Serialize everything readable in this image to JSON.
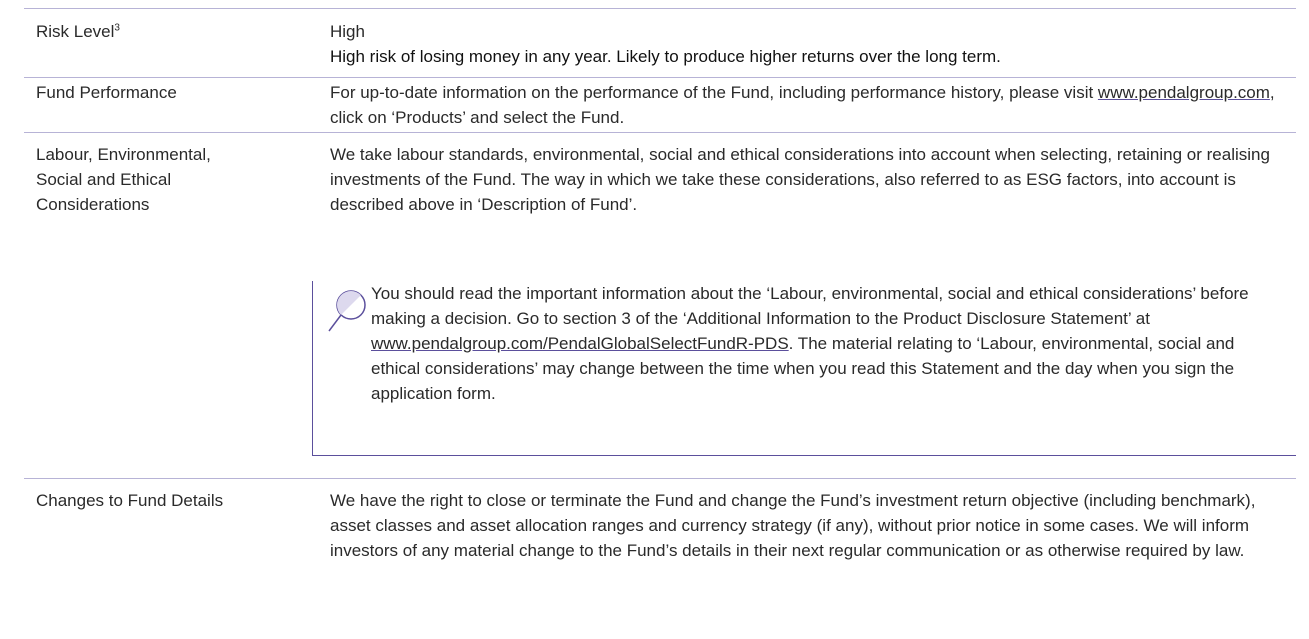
{
  "rows": {
    "risk": {
      "label": "Risk Level",
      "label_sup": "3",
      "value": "High",
      "description": "High risk of losing money in any year. Likely to produce higher returns over the long term."
    },
    "performance": {
      "label": "Fund Performance",
      "text_before_link": "For up-to-date information on the performance of the Fund, including performance history, please visit ",
      "link": "www.pendalgroup.com",
      "text_after_link": ", click on ‘Products’ and select the Fund."
    },
    "esg": {
      "label": "Labour, Environmental, Social and Ethical Considerations",
      "text": "We take labour standards, environmental, social and ethical considerations into account when selecting, retaining or realising investments of the Fund. The way in which we take these considerations, also referred to as ESG factors, into account is described above in ‘Description of Fund’.",
      "note": {
        "icon": "magnifier-icon",
        "text_before_link": "You should read the important information about the ‘Labour, environmental, social and ethical considerations’ before making a decision. Go to section 3 of the ‘Additional Information to the Product Disclosure Statement’ at ",
        "link": "www.pendalgroup.com/PendalGlobalSelectFundR-PDS",
        "text_after_link": ". The material relating to ‘Labour, environmental, social and ethical considerations’ may change between the time when you read this Statement and the day when you sign the application form."
      }
    },
    "changes": {
      "label": "Changes to Fund Details",
      "text": "We have the right to close or terminate the Fund and change the Fund’s investment return objective (including benchmark), asset classes and asset allocation ranges and currency strategy (if any), without prior notice in some cases. We will inform investors of any material change to the Fund’s details in their next regular communication or as otherwise required by law."
    }
  },
  "colors": {
    "rule": "#b7b3d6",
    "accent": "#5b4f9c",
    "text": "#2a2a2a"
  }
}
